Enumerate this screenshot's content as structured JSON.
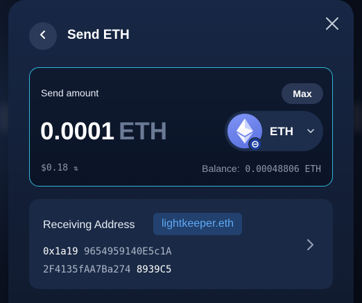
{
  "header": {
    "title": "Send ETH"
  },
  "amount_card": {
    "label": "Send amount",
    "max_label": "Max",
    "amount": "0.0001",
    "ticker": "ETH",
    "fiat_value": "$0.18",
    "balance_label": "Balance:",
    "balance_value": "0.00048806 ETH",
    "token": {
      "symbol": "ETH",
      "icon": "ethereum-icon",
      "network_badge": "network-badge-icon"
    }
  },
  "receiving": {
    "label": "Receiving Address",
    "ens_name": "lightkeeper.eth",
    "address_line1_hi": "0x1a19",
    "address_line1_lo": "9654959140E5c1A",
    "address_line2_lo": "2F4135fAA7Ba274",
    "address_line2_hi": "8939C5"
  },
  "colors": {
    "accent_border": "#2fb6d8",
    "ens_text": "#5fa8f5",
    "eth_icon": "#6f85ee"
  }
}
